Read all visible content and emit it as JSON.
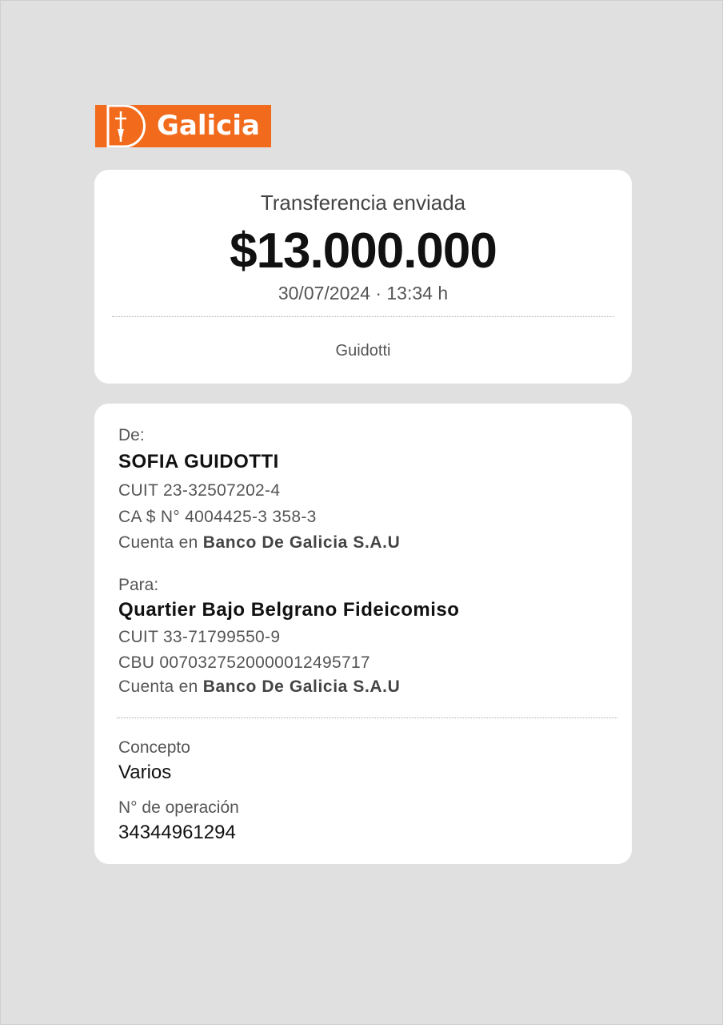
{
  "brand": {
    "name": "Galicia",
    "color": "#f26b1d"
  },
  "summary": {
    "title": "Transferencia enviada",
    "amount": "$13.000.000",
    "datetime": "30/07/2024 · 13:34 h",
    "name": "Guidotti"
  },
  "from": {
    "label": "De:",
    "name": "SOFIA GUIDOTTI",
    "cuit": "CUIT 23-32507202-4",
    "account": "CA $ N° 4004425-3 358-3",
    "bank_prefix": "Cuenta en ",
    "bank": "Banco De Galicia S.A.U"
  },
  "to": {
    "label": "Para:",
    "name": "Quartier Bajo Belgrano Fideicomiso",
    "cuit": "CUIT 33-71799550-9",
    "cbu": "CBU 0070327520000012495717",
    "bank_prefix": "Cuenta en ",
    "bank": "Banco De Galicia S.A.U"
  },
  "concept": {
    "label": "Concepto",
    "value": "Varios"
  },
  "operation": {
    "label": "N° de operación",
    "value": "34344961294"
  }
}
